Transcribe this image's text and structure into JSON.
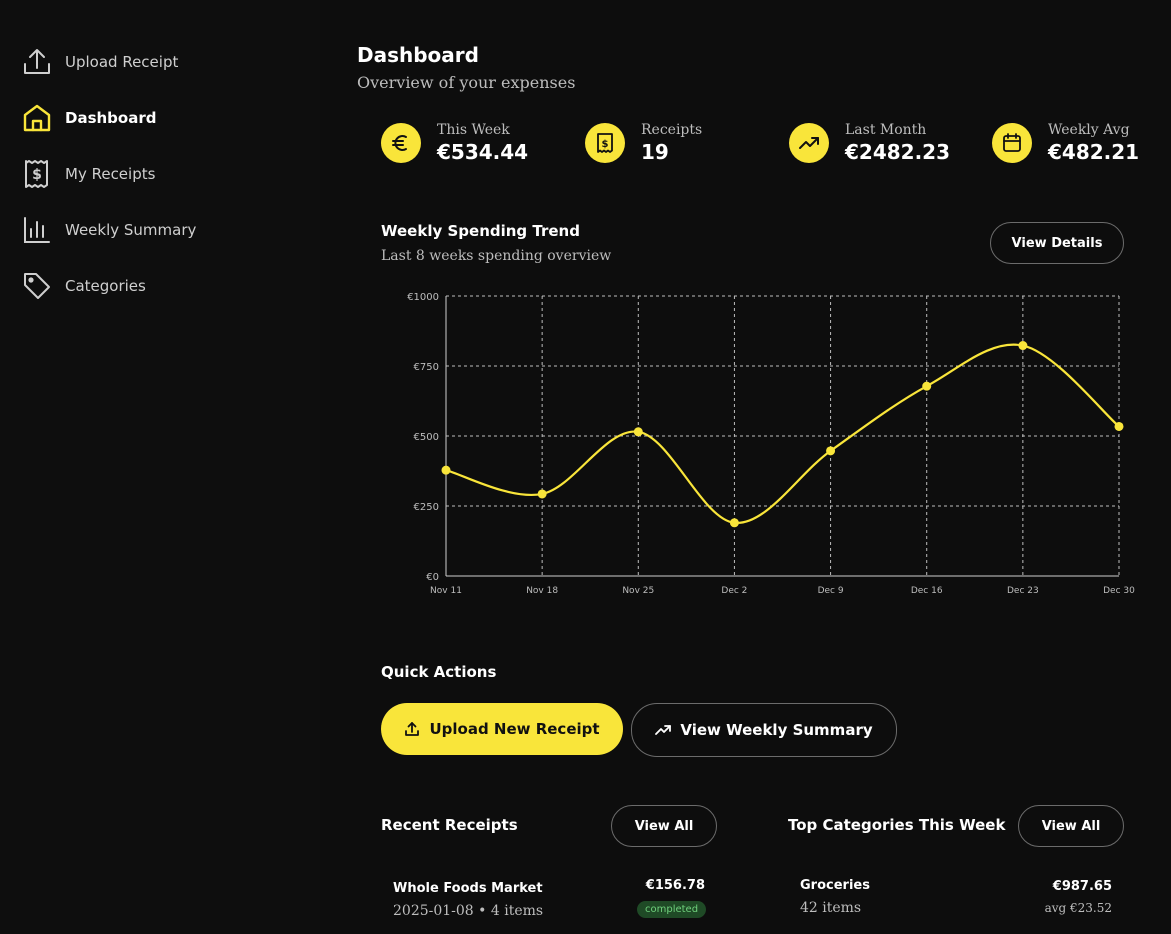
{
  "sidebar": {
    "items": [
      {
        "label": "Upload Receipt",
        "icon": "upload-icon"
      },
      {
        "label": "Dashboard",
        "icon": "home-icon"
      },
      {
        "label": "My Receipts",
        "icon": "receipt-icon"
      },
      {
        "label": "Weekly Summary",
        "icon": "bar-chart-icon"
      },
      {
        "label": "Categories",
        "icon": "tag-icon"
      }
    ],
    "active_index": 1
  },
  "header": {
    "title": "Dashboard",
    "subtitle": "Overview of your expenses"
  },
  "stats": [
    {
      "label": "This Week",
      "value": "€534.44",
      "icon": "euro-icon"
    },
    {
      "label": "Receipts",
      "value": "19",
      "icon": "receipt-icon"
    },
    {
      "label": "Last Month",
      "value": "€2482.23",
      "icon": "trending-up-icon"
    },
    {
      "label": "Weekly Avg",
      "value": "€482.21",
      "icon": "calendar-icon"
    }
  ],
  "chart_section": {
    "title": "Weekly Spending Trend",
    "subtitle": "Last 8 weeks spending overview",
    "button": "View Details"
  },
  "chart_data": {
    "type": "line",
    "categories": [
      "Nov 11",
      "Nov 18",
      "Nov 25",
      "Dec 2",
      "Dec 9",
      "Dec 16",
      "Dec 23",
      "Dec 30"
    ],
    "series": [
      {
        "values": [
          378,
          293,
          515,
          190,
          447,
          678,
          823,
          534
        ]
      }
    ],
    "y_ticks": [
      "€0",
      "€250",
      "€500",
      "€750",
      "€1000"
    ],
    "ylim": [
      0,
      1000
    ],
    "grid": true,
    "line_color": "#f9e53a"
  },
  "quick_actions": {
    "title": "Quick Actions",
    "primary": "Upload New Receipt",
    "secondary": "View Weekly Summary"
  },
  "recent_receipts": {
    "title": "Recent Receipts",
    "button": "View All",
    "items": [
      {
        "name": "Whole Foods Market",
        "meta": "2025-01-08 • 4 items",
        "amount": "€156.78",
        "status": "completed"
      }
    ]
  },
  "top_categories": {
    "title": "Top Categories This Week",
    "button": "View All",
    "items": [
      {
        "name": "Groceries",
        "meta": "42 items",
        "amount": "€987.65",
        "avg": "avg €23.52"
      }
    ]
  },
  "colors": {
    "accent": "#f9e53a",
    "background": "#0d0d0d",
    "status_completed": "#6fd07c"
  }
}
